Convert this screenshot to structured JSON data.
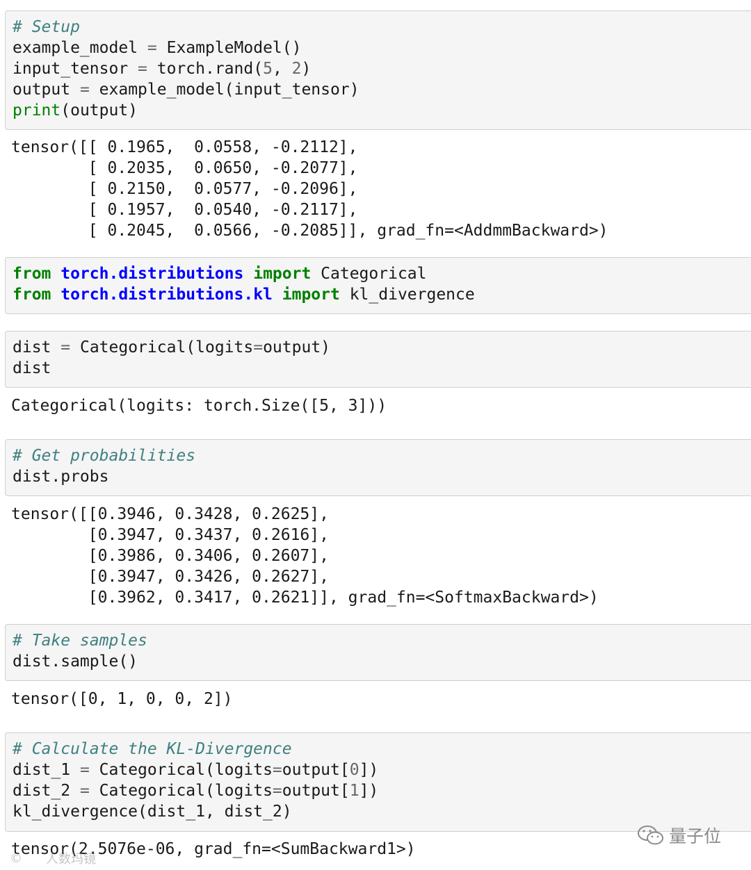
{
  "cells": [
    {
      "input": {
        "comment": "# Setup",
        "l1": {
          "a": "example_model",
          "b": "ExampleModel()"
        },
        "l2": {
          "a": "input_tensor",
          "b": "torch.rand(",
          "n1": "5",
          "c": ", ",
          "n2": "2",
          "d": ")"
        },
        "l3": {
          "a": "output",
          "b": "example_model(input_tensor)"
        },
        "l4": {
          "fn": "print",
          "b": "(output)"
        }
      },
      "output": [
        "tensor([[ 0.1965,  0.0558, -0.2112],",
        "        [ 0.2035,  0.0650, -0.2077],",
        "        [ 0.2150,  0.0577, -0.2096],",
        "        [ 0.1957,  0.0540, -0.2117],",
        "        [ 0.2045,  0.0566, -0.2085]], grad_fn=<AddmmBackward>)"
      ]
    },
    {
      "input": {
        "l1": {
          "from": "from",
          "mod": "torch.distributions",
          "imp": "import",
          "name": "Categorical"
        },
        "l2": {
          "from": "from",
          "mod": "torch.distributions.kl",
          "imp": "import",
          "name": "kl_divergence"
        }
      }
    },
    {
      "input": {
        "l1": {
          "a": "dist",
          "b": "Categorical(logits",
          "c": "output)"
        },
        "l2": "dist"
      },
      "output": [
        "Categorical(logits: torch.Size([5, 3]))"
      ]
    },
    {
      "input": {
        "comment": "# Get probabilities",
        "l1": "dist.probs"
      },
      "output": [
        "tensor([[0.3946, 0.3428, 0.2625],",
        "        [0.3947, 0.3437, 0.2616],",
        "        [0.3986, 0.3406, 0.2607],",
        "        [0.3947, 0.3426, 0.2627],",
        "        [0.3962, 0.3417, 0.2621]], grad_fn=<SoftmaxBackward>)"
      ]
    },
    {
      "input": {
        "comment": "# Take samples",
        "l1": "dist.sample()"
      },
      "output": [
        "tensor([0, 1, 0, 0, 2])"
      ]
    },
    {
      "input": {
        "comment": "# Calculate the KL-Divergence",
        "l1": {
          "a": "dist_1",
          "b": "Categorical(logits",
          "c": "output[",
          "n": "0",
          "d": "])"
        },
        "l2": {
          "a": "dist_2",
          "b": "Categorical(logits",
          "c": "output[",
          "n": "1",
          "d": "])"
        },
        "l3": "kl_divergence(dist_1, dist_2)"
      },
      "output": [
        "tensor(2.5076e-06, grad_fn=<SumBackward1>)"
      ]
    }
  ],
  "watermark": {
    "brand": "量子位",
    "bottom_left": "人数玛镜"
  }
}
